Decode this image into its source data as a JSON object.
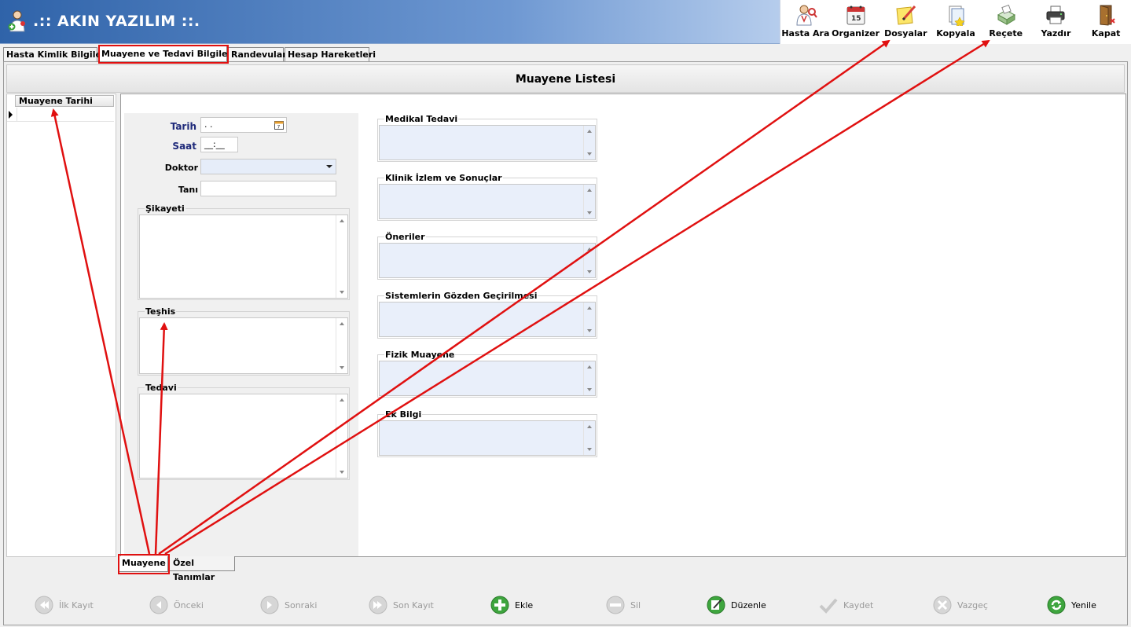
{
  "app": {
    "title": ".:: AKIN YAZILIM ::."
  },
  "toolbar": [
    {
      "label": "Hasta Ara",
      "icon": "doctor-search-icon"
    },
    {
      "label": "Organizer",
      "icon": "calendar-icon"
    },
    {
      "label": "Dosyalar",
      "icon": "note-pencil-icon"
    },
    {
      "label": "Kopyala",
      "icon": "copy-document-icon"
    },
    {
      "label": "Reçete",
      "icon": "prescription-printer-icon"
    },
    {
      "label": "Yazdır",
      "icon": "printer-icon"
    },
    {
      "label": "Kapat",
      "icon": "exit-door-icon"
    }
  ],
  "top_tabs": [
    {
      "label": "Hasta Kimlik Bilgileri",
      "active": false
    },
    {
      "label": "Muayene ve Tedavi Bilgileri",
      "active": true
    },
    {
      "label": "Randevular",
      "active": false
    },
    {
      "label": "Hesap Hareketleri",
      "active": false
    }
  ],
  "list_title": "Muayene  Listesi",
  "grid": {
    "column_header": "Muayene Tarihi"
  },
  "form": {
    "tarih_label": "Tarih",
    "tarih_value": " . .",
    "saat_label": "Saat",
    "saat_value": "__:__",
    "doktor_label": "Doktor",
    "doktor_value": "",
    "tani_label": "Tanı",
    "tani_value": "",
    "sikayeti_label": "Şikayeti",
    "teshis_label": "Teşhis",
    "tedavi_label": "Tedavi"
  },
  "right_memos": [
    {
      "label": "Medikal Tedavi"
    },
    {
      "label": "Klinik İzlem ve Sonuçlar"
    },
    {
      "label": "Öneriler"
    },
    {
      "label": "Sistemlerin Gözden Geçirilmesi"
    },
    {
      "label": "Fizik Muayene"
    },
    {
      "label": "Ek Bilgi"
    }
  ],
  "bottom_tabs": [
    {
      "label": "Muayene",
      "active": true
    },
    {
      "label": "Özel Tanımlar",
      "active": false
    }
  ],
  "nav": [
    {
      "label": "İlk Kayıt",
      "enabled": false,
      "icon": "first-record-icon"
    },
    {
      "label": "Önceki",
      "enabled": false,
      "icon": "previous-icon"
    },
    {
      "label": "Sonraki",
      "enabled": false,
      "icon": "next-icon"
    },
    {
      "label": "Son Kayıt",
      "enabled": false,
      "icon": "last-record-icon"
    },
    {
      "label": "Ekle",
      "enabled": true,
      "icon": "add-icon"
    },
    {
      "label": "Sil",
      "enabled": false,
      "icon": "delete-icon"
    },
    {
      "label": "Düzenle",
      "enabled": true,
      "icon": "edit-icon"
    },
    {
      "label": "Kaydet",
      "enabled": false,
      "icon": "save-check-icon"
    },
    {
      "label": "Vazgeç",
      "enabled": false,
      "icon": "cancel-icon"
    },
    {
      "label": "Yenile",
      "enabled": true,
      "icon": "refresh-icon"
    }
  ],
  "colors": {
    "highlight": "#e01010",
    "header_dark": "#2f63a9",
    "memo_blue": "#e9effa"
  }
}
